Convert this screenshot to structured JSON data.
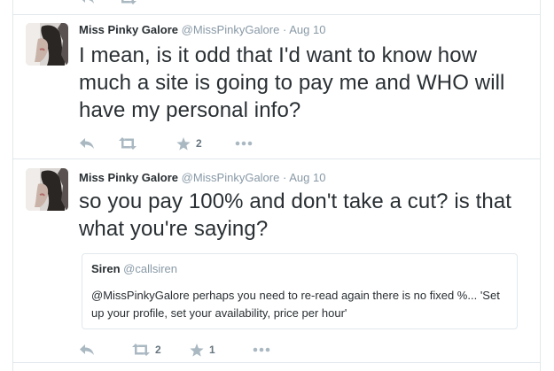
{
  "tweets": [
    {
      "author_name": "Miss Pinky Galore",
      "screen_name": "@MissPinkyGalore",
      "separator": "·",
      "time": "Aug 10",
      "text": "I mean, is it odd that I'd want to know how much a site is going to pay me and WHO will have my personal info?",
      "retweets": "",
      "likes": "2",
      "icons": [
        "reply-icon",
        "retweet-icon",
        "star-icon",
        "more-icon"
      ]
    },
    {
      "author_name": "Miss Pinky Galore",
      "screen_name": "@MissPinkyGalore",
      "separator": "·",
      "time": "Aug 10",
      "text": "so you pay 100% and don't take a cut? is that what you're saying?",
      "quoted": {
        "author_name": "Siren",
        "screen_name": "@callsiren",
        "text": "@MissPinkyGalore perhaps you need to re-read again there is no fixed %... 'Set up your profile, set your availability, price per hour'"
      },
      "retweets": "2",
      "likes": "1",
      "icons": [
        "reply-icon",
        "retweet-icon",
        "star-icon",
        "more-icon"
      ]
    }
  ],
  "colors": {
    "text": "#292f33",
    "muted": "#8899a6",
    "action": "#aab8c2",
    "border": "#e1e8ed"
  }
}
